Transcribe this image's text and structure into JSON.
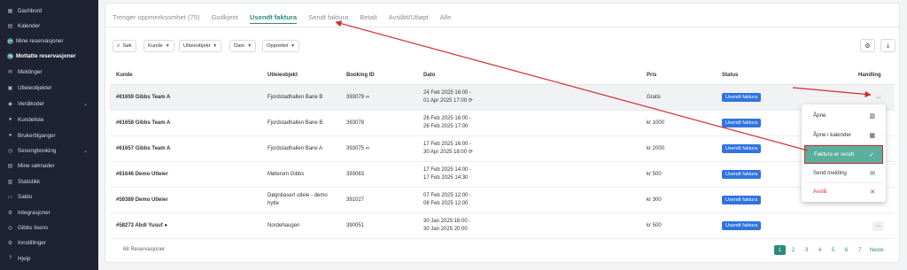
{
  "sidebar": {
    "items": [
      {
        "label": "Dashbord",
        "icon": "dashboard-icon",
        "glyph": "▦",
        "chevron": false
      },
      {
        "label": "Kalender",
        "icon": "calendar-icon",
        "glyph": "▤",
        "chevron": false
      },
      {
        "label": "Mine reservasjoner",
        "icon": "badge-icon",
        "badge": "27",
        "chevron": false
      },
      {
        "label": "Mottatte reservasjoner",
        "icon": "badge-icon",
        "badge": "75",
        "active": true,
        "chevron": false
      },
      {
        "label": "Meldinger",
        "icon": "mail-icon",
        "glyph": "✉",
        "chevron": false
      },
      {
        "label": "Utleieobjekter",
        "icon": "building-icon",
        "glyph": "▣",
        "chevron": false
      },
      {
        "label": "Verdikoder",
        "icon": "tag-icon",
        "glyph": "◆",
        "chevron": true
      },
      {
        "label": "Kundeliste",
        "icon": "users-icon",
        "glyph": "●",
        "chevron": false
      },
      {
        "label": "Brukertilganger",
        "icon": "user-key-icon",
        "glyph": "●",
        "chevron": false
      },
      {
        "label": "Sesongbooking",
        "icon": "season-icon",
        "glyph": "◷",
        "chevron": true
      },
      {
        "label": "Mine søknader",
        "icon": "document-icon",
        "glyph": "▤",
        "chevron": false
      },
      {
        "label": "Statistikk",
        "icon": "chart-icon",
        "glyph": "▥",
        "chevron": false
      },
      {
        "label": "Saldo",
        "icon": "wallet-icon",
        "glyph": "▭",
        "chevron": false
      },
      {
        "label": "Integrasjoner",
        "icon": "plug-icon",
        "glyph": "⚙",
        "chevron": false
      },
      {
        "label": "Gibbs lisens",
        "icon": "license-icon",
        "glyph": "◎",
        "chevron": false
      },
      {
        "label": "Innstillinger",
        "icon": "gear-icon",
        "glyph": "⚙",
        "chevron": false
      },
      {
        "label": "Hjelp",
        "icon": "help-icon",
        "glyph": "?",
        "chevron": false
      }
    ]
  },
  "tabs": [
    {
      "label": "Trenger oppmerksomhet (75)",
      "active": false
    },
    {
      "label": "Godkjent",
      "active": false
    },
    {
      "label": "Usendt faktura",
      "active": true
    },
    {
      "label": "Sendt faktura",
      "active": false
    },
    {
      "label": "Betalt",
      "active": false
    },
    {
      "label": "Avslått/Utløpt",
      "active": false
    },
    {
      "label": "Alle",
      "active": false
    }
  ],
  "filters": {
    "search": "Søk",
    "kunde": "Kunde",
    "utleieobjekt": "Utleieobjekt",
    "dato": "Dato",
    "opprettet": "Opprettet"
  },
  "table": {
    "headers": {
      "kunde": "Kunde",
      "utleieobjekt": "Utleieobjekt",
      "booking_id": "Booking ID",
      "dato": "Dato",
      "pris": "Pris",
      "status": "Status",
      "handling": "Handling"
    },
    "rows": [
      {
        "kunde": "#61659 Gibbs Team A",
        "utleieobjekt": "Fjordstadhallen Bane B",
        "utleieobjekt2": "",
        "booking_id": "393079",
        "link_icon": true,
        "chat_icon": false,
        "dato1": "24 Feb 2025 16:00 -",
        "dato2": "01 Apr 2025 17:00",
        "repeat_icon": true,
        "pris": "Gratis",
        "status": "Usendt faktura"
      },
      {
        "kunde": "#61658 Gibbs Team A",
        "utleieobjekt": "Fjordstadhallen Bane B",
        "utleieobjekt2": "",
        "booking_id": "393078",
        "link_icon": false,
        "chat_icon": false,
        "dato1": "26 Feb 2025 16:00 -",
        "dato2": "26 Feb 2025 17:00",
        "repeat_icon": false,
        "pris": "kr 1000",
        "status": "Usendt faktura"
      },
      {
        "kunde": "#61657 Gibbs Team A",
        "utleieobjekt": "Fjordstadhallen Bane A",
        "utleieobjekt2": "",
        "booking_id": "393075",
        "link_icon": true,
        "chat_icon": false,
        "dato1": "17 Feb 2025 16:00 -",
        "dato2": "30 Apr 2025 18:00",
        "repeat_icon": true,
        "pris": "kr 2000",
        "status": "Usendt faktura"
      },
      {
        "kunde": "#61646 Demo Utleier",
        "utleieobjekt": "Møterom Gibbs",
        "utleieobjekt2": "",
        "booking_id": "393063",
        "link_icon": false,
        "chat_icon": false,
        "dato1": "17 Feb 2025 14:00 -",
        "dato2": "17 Feb 2025 14:30",
        "repeat_icon": false,
        "pris": "kr 500",
        "status": "Usendt faktura"
      },
      {
        "kunde": "#59389 Demo Utleier",
        "utleieobjekt": "Døgnbasert utleie - demo",
        "utleieobjekt2": "hytte",
        "booking_id": "391027",
        "link_icon": false,
        "chat_icon": false,
        "dato1": "07 Feb 2025 12:00 -",
        "dato2": "08 Feb 2025 12:00",
        "repeat_icon": false,
        "pris": "kr 300",
        "status": "Usendt faktura"
      },
      {
        "kunde": "#58273 Abdi Yusuf",
        "utleieobjekt": "Nordehaugen",
        "utleieobjekt2": "",
        "booking_id": "390051",
        "link_icon": false,
        "chat_icon": true,
        "dato1": "30 Jan 2025 16:00 -",
        "dato2": "30 Jan 2025 20:00",
        "repeat_icon": false,
        "pris": "kr 500",
        "status": "Usendt faktura"
      }
    ]
  },
  "footer": {
    "count": "68 Reservasjoner",
    "pages": [
      "1",
      "2",
      "3",
      "4",
      "5",
      "6",
      "7"
    ],
    "next": "Neste"
  },
  "menu": {
    "items": [
      {
        "label": "Åpne",
        "icon": "book-icon",
        "glyph": "▥"
      },
      {
        "label": "Åpne i kalender",
        "icon": "calendar-icon",
        "glyph": "▦"
      },
      {
        "label": "Faktura er sendt",
        "icon": "check-icon",
        "glyph": "✓",
        "highlight": true
      },
      {
        "label": "Send melding",
        "icon": "envelope-icon",
        "glyph": "✉"
      },
      {
        "label": "Avslå",
        "icon": "close-icon",
        "glyph": "✕",
        "danger": true
      }
    ]
  },
  "colors": {
    "accent": "#2d8a7a",
    "status": "#2f74e0",
    "annotation": "#d22f2f",
    "sidebar": "#1f2233"
  }
}
